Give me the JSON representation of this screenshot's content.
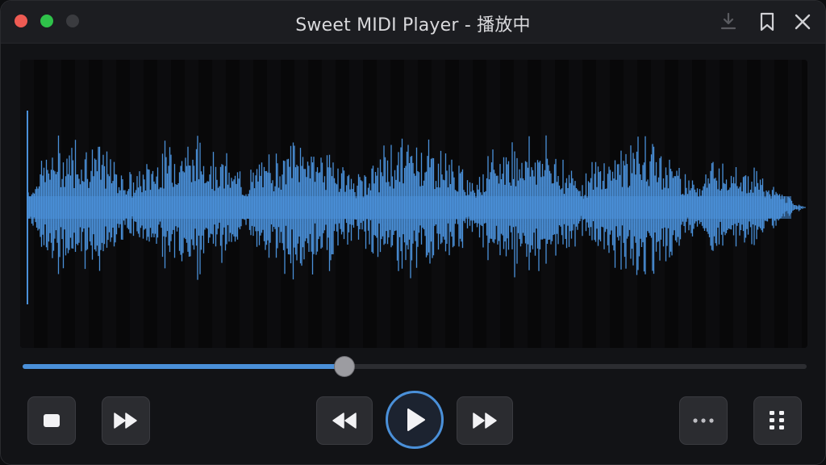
{
  "window": {
    "title": "Sweet MIDI Player - 播放中",
    "controls": [
      "close",
      "maximize",
      "minimize"
    ]
  },
  "titlebar_actions": [
    {
      "name": "download-icon"
    },
    {
      "name": "bookmark-icon"
    },
    {
      "name": "close-icon"
    }
  ],
  "playback": {
    "progress": 0.41
  },
  "transport": [
    {
      "name": "stop-button",
      "icon": "stop-icon"
    },
    {
      "name": "skip-forward-button",
      "icon": "fast-forward-icon"
    },
    {
      "name": "rewind-button",
      "icon": "rewind-icon"
    },
    {
      "name": "play-button",
      "icon": "play-icon"
    },
    {
      "name": "fast-forward-button",
      "icon": "fast-forward-icon"
    },
    {
      "name": "more-button",
      "icon": "more-horizontal-icon"
    },
    {
      "name": "playlist-button",
      "icon": "grid-dots-icon"
    }
  ],
  "colors": {
    "accent": "#4a90d9",
    "waveform": "#4a90d9",
    "background": "#121316",
    "titlebar": "#1c1d21"
  }
}
